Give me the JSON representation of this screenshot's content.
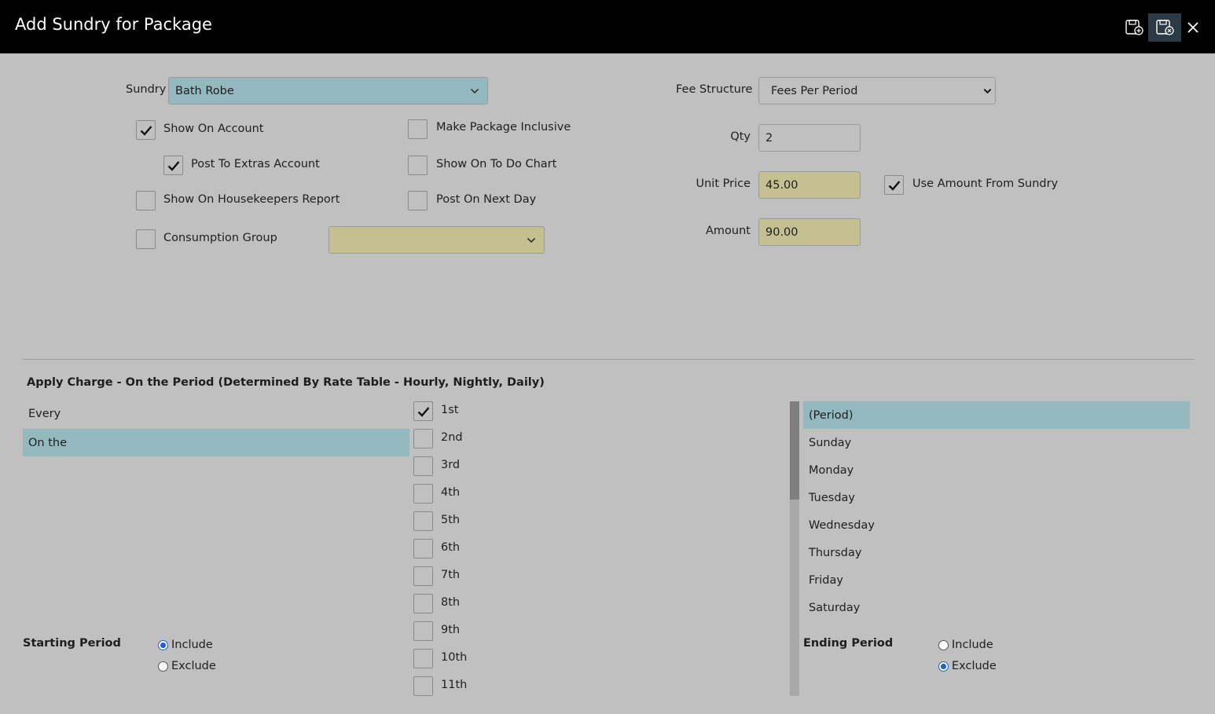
{
  "window": {
    "title": "Add Sundry for Package"
  },
  "toolbar": {
    "icons": [
      "save-new-icon",
      "save-close-icon",
      "close-icon"
    ]
  },
  "form": {
    "sundry_label": "Sundry",
    "sundry_value": "Bath Robe",
    "fee_structure_label": "Fee Structure",
    "fee_structure_value": "Fees Per Period",
    "qty_label": "Qty",
    "qty_value": "2",
    "unit_price_label": "Unit Price",
    "unit_price_value": "45.00",
    "use_amount_label": "Use Amount From Sundry",
    "amount_label": "Amount",
    "amount_value": "90.00",
    "show_on_account": "Show On Account",
    "post_to_extras": "Post To Extras Account",
    "show_on_housekeepers": "Show On Housekeepers Report",
    "consumption_group": "Consumption Group",
    "make_package_inclusive": "Make Package Inclusive",
    "show_on_todo": "Show On To Do Chart",
    "post_on_next_day": "Post On Next Day"
  },
  "apply_charge": {
    "title": "Apply Charge - On the Period (Determined By Rate Table - Hourly, Nightly, Daily)",
    "modes": [
      "Every",
      "On the"
    ],
    "occurrences": [
      "1st",
      "2nd",
      "3rd",
      "4th",
      "5th",
      "6th",
      "7th",
      "8th",
      "9th",
      "10th",
      "11th"
    ],
    "days": [
      "(Period)",
      "Sunday",
      "Monday",
      "Tuesday",
      "Wednesday",
      "Thursday",
      "Friday",
      "Saturday"
    ]
  },
  "starting_period": {
    "label": "Starting Period",
    "include": "Include",
    "exclude": "Exclude"
  },
  "ending_period": {
    "label": "Ending Period",
    "include": "Include",
    "exclude": "Exclude"
  },
  "colors": {
    "titlebar": "#000000",
    "background": "#c0c0c0",
    "selected": "#93b9bf",
    "readonly": "#c4c091"
  }
}
